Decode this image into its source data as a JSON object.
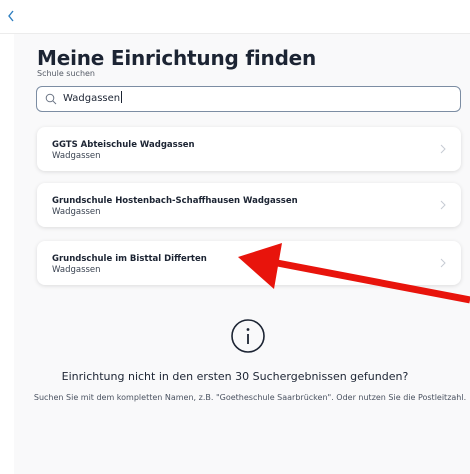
{
  "header": {
    "back_icon": "chevron-left-icon"
  },
  "page": {
    "title": "Meine Einrichtung finden",
    "subtitle": "Schule suchen"
  },
  "search": {
    "value": "Wadgassen",
    "icon": "search-icon"
  },
  "results": [
    {
      "name": "GGTS Abteischule Wadgassen",
      "city": "Wadgassen"
    },
    {
      "name": "Grundschule Hostenbach-Schaffhausen Wadgassen",
      "city": "Wadgassen"
    },
    {
      "name": "Grundschule im Bisttal Differten",
      "city": "Wadgassen"
    }
  ],
  "info": {
    "icon": "info-icon",
    "heading": "Einrichtung nicht in den ersten 30 Suchergebnissen gefunden?",
    "hint": "Suchen Sie mit dem kompletten Namen, z.B. \"Goetheschule Saarbrücken\". Oder nutzen Sie die Postleitzahl."
  },
  "colors": {
    "accent": "#2f7fc0",
    "annotation_arrow": "#e8140c",
    "panel_bg": "#f9f9fa"
  }
}
